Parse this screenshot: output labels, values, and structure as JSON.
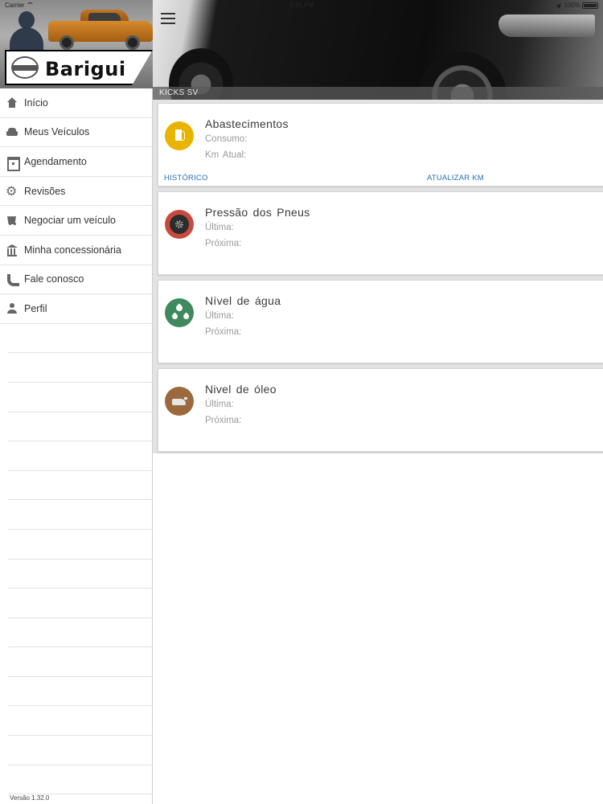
{
  "status_bar": {
    "carrier": "Carrier",
    "time": "5:35 PM",
    "battery": "100%"
  },
  "sidebar": {
    "brand": "Barigui",
    "items": [
      {
        "label": "Início",
        "icon": "home-icon"
      },
      {
        "label": "Meus Veículos",
        "icon": "car-icon"
      },
      {
        "label": "Agendamento",
        "icon": "calendar-icon"
      },
      {
        "label": "Revisões",
        "icon": "gear-icon"
      },
      {
        "label": "Negociar um veículo",
        "icon": "cart-icon"
      },
      {
        "label": "Minha concessionária",
        "icon": "bank-icon"
      },
      {
        "label": "Fale conosco",
        "icon": "phone-icon"
      },
      {
        "label": "Perfil",
        "icon": "person-icon"
      }
    ],
    "version": "Versão 1.32.0"
  },
  "header": {
    "vehicle_label": "KICKS SV"
  },
  "cards": [
    {
      "title": "Abastecimentos",
      "line1": "Consumo:",
      "line2": "Km  Atual:",
      "link_left": "HISTÓRICO",
      "link_right": "ATUALIZAR KM",
      "icon": "fuel-icon",
      "icon_color": "#e8b400"
    },
    {
      "title": "Pressão  dos  Pneus",
      "line1": "Última:",
      "line2": "Próxima:",
      "icon": "tire-icon",
      "icon_color": "#c84a3f"
    },
    {
      "title": "Nível  de  água",
      "line1": "Última:",
      "line2": "Próxima:",
      "icon": "water-drops-icon",
      "icon_color": "#3e8a5e"
    },
    {
      "title": "Nivel  de  óleo",
      "line1": "Última:",
      "line2": "Próxima:",
      "icon": "oil-can-icon",
      "icon_color": "#9a6a3e"
    }
  ],
  "colors": {
    "link": "#2a6fb0",
    "sidebar_border": "#cfcfcf",
    "card_bg": "#ffffff",
    "cards_area_bg": "#e3e3e3"
  }
}
